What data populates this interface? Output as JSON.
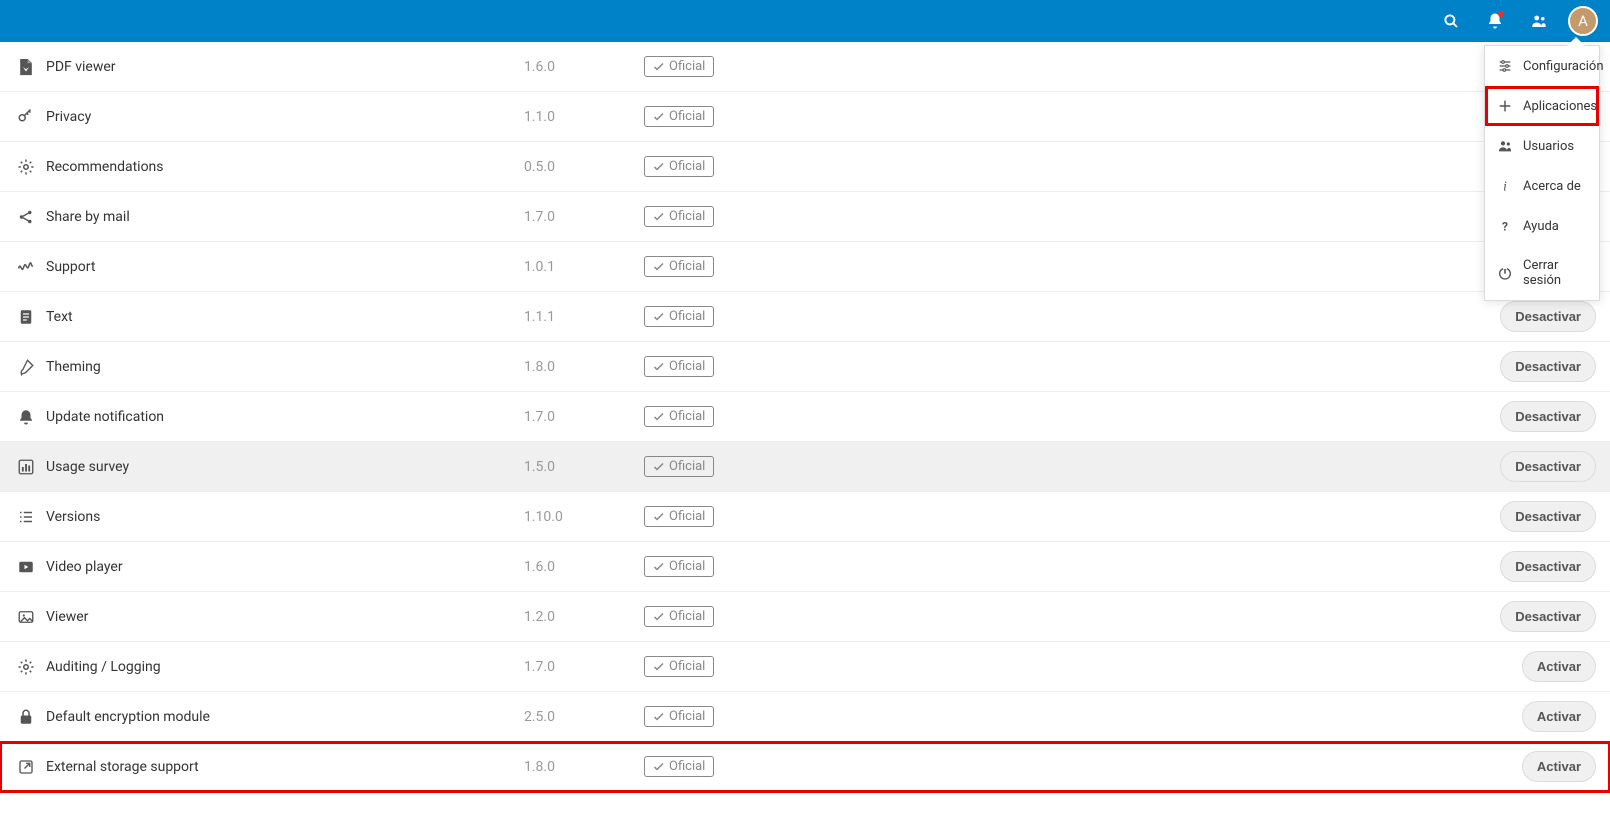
{
  "header": {
    "avatar_initial": "A"
  },
  "dropdown": {
    "items": [
      {
        "icon": "settings-list",
        "label": "Configuración",
        "active": false,
        "highlighted": false
      },
      {
        "icon": "plus",
        "label": "Aplicaciones",
        "active": true,
        "highlighted": true
      },
      {
        "icon": "users",
        "label": "Usuarios",
        "active": false,
        "highlighted": false
      },
      {
        "icon": "info",
        "label": "Acerca de",
        "active": false,
        "highlighted": false
      },
      {
        "icon": "help",
        "label": "Ayuda",
        "active": false,
        "highlighted": false
      },
      {
        "icon": "power",
        "label": "Cerrar sesión",
        "active": false,
        "highlighted": false
      }
    ]
  },
  "labels": {
    "official": "Oficial",
    "deactivate": "Desactivar",
    "activate": "Activar"
  },
  "apps": [
    {
      "icon": "pdf",
      "name": "PDF viewer",
      "version": "1.6.0",
      "level": "official",
      "action": null,
      "hovered": false,
      "highlighted": false
    },
    {
      "icon": "key",
      "name": "Privacy",
      "version": "1.1.0",
      "level": "official",
      "action": null,
      "hovered": false,
      "highlighted": false
    },
    {
      "icon": "gear",
      "name": "Recommendations",
      "version": "0.5.0",
      "level": "official",
      "action": null,
      "hovered": false,
      "highlighted": false
    },
    {
      "icon": "share",
      "name": "Share by mail",
      "version": "1.7.0",
      "level": "official",
      "action": null,
      "hovered": false,
      "highlighted": false
    },
    {
      "icon": "wave",
      "name": "Support",
      "version": "1.0.1",
      "level": "official",
      "action": null,
      "hovered": false,
      "highlighted": false
    },
    {
      "icon": "doc",
      "name": "Text",
      "version": "1.1.1",
      "level": "official",
      "action": "deactivate",
      "hovered": false,
      "highlighted": false
    },
    {
      "icon": "brush",
      "name": "Theming",
      "version": "1.8.0",
      "level": "official",
      "action": "deactivate",
      "hovered": false,
      "highlighted": false
    },
    {
      "icon": "bell",
      "name": "Update notification",
      "version": "1.7.0",
      "level": "official",
      "action": "deactivate",
      "hovered": false,
      "highlighted": false
    },
    {
      "icon": "chart",
      "name": "Usage survey",
      "version": "1.5.0",
      "level": "official",
      "action": "deactivate",
      "hovered": true,
      "highlighted": false
    },
    {
      "icon": "list",
      "name": "Versions",
      "version": "1.10.0",
      "level": "official",
      "action": "deactivate",
      "hovered": false,
      "highlighted": false
    },
    {
      "icon": "play",
      "name": "Video player",
      "version": "1.6.0",
      "level": "official",
      "action": "deactivate",
      "hovered": false,
      "highlighted": false
    },
    {
      "icon": "image",
      "name": "Viewer",
      "version": "1.2.0",
      "level": "official",
      "action": "deactivate",
      "hovered": false,
      "highlighted": false
    },
    {
      "icon": "gear",
      "name": "Auditing / Logging",
      "version": "1.7.0",
      "level": "official",
      "action": "activate",
      "hovered": false,
      "highlighted": false
    },
    {
      "icon": "lock",
      "name": "Default encryption module",
      "version": "2.5.0",
      "level": "official",
      "action": "activate",
      "hovered": false,
      "highlighted": false
    },
    {
      "icon": "external",
      "name": "External storage support",
      "version": "1.8.0",
      "level": "official",
      "action": "activate",
      "hovered": false,
      "highlighted": true
    }
  ]
}
